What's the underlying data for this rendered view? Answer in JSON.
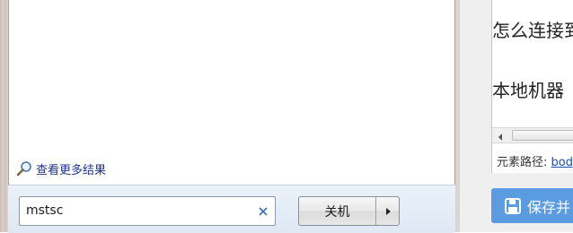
{
  "start_menu": {
    "more_results_label": "查看更多结果",
    "search": {
      "value": "mstsc"
    },
    "shutdown_label": "关机"
  },
  "editor": {
    "lines": [
      "怎么连接到",
      "本地机器"
    ],
    "element_path_label": "元素路径:",
    "element_path_link": "body"
  },
  "save_button": {
    "label": "保存并"
  },
  "icons": {
    "more_results": "magnifier-icon",
    "clear": "close-icon",
    "shutdown_menu": "arrow-right-icon",
    "scroll_left": "arrow-left-icon",
    "save": "floppy-disk-icon"
  },
  "colors": {
    "save_button": "#5b9be0",
    "link": "#1e3287",
    "search_strip": "#dfe8f4"
  }
}
